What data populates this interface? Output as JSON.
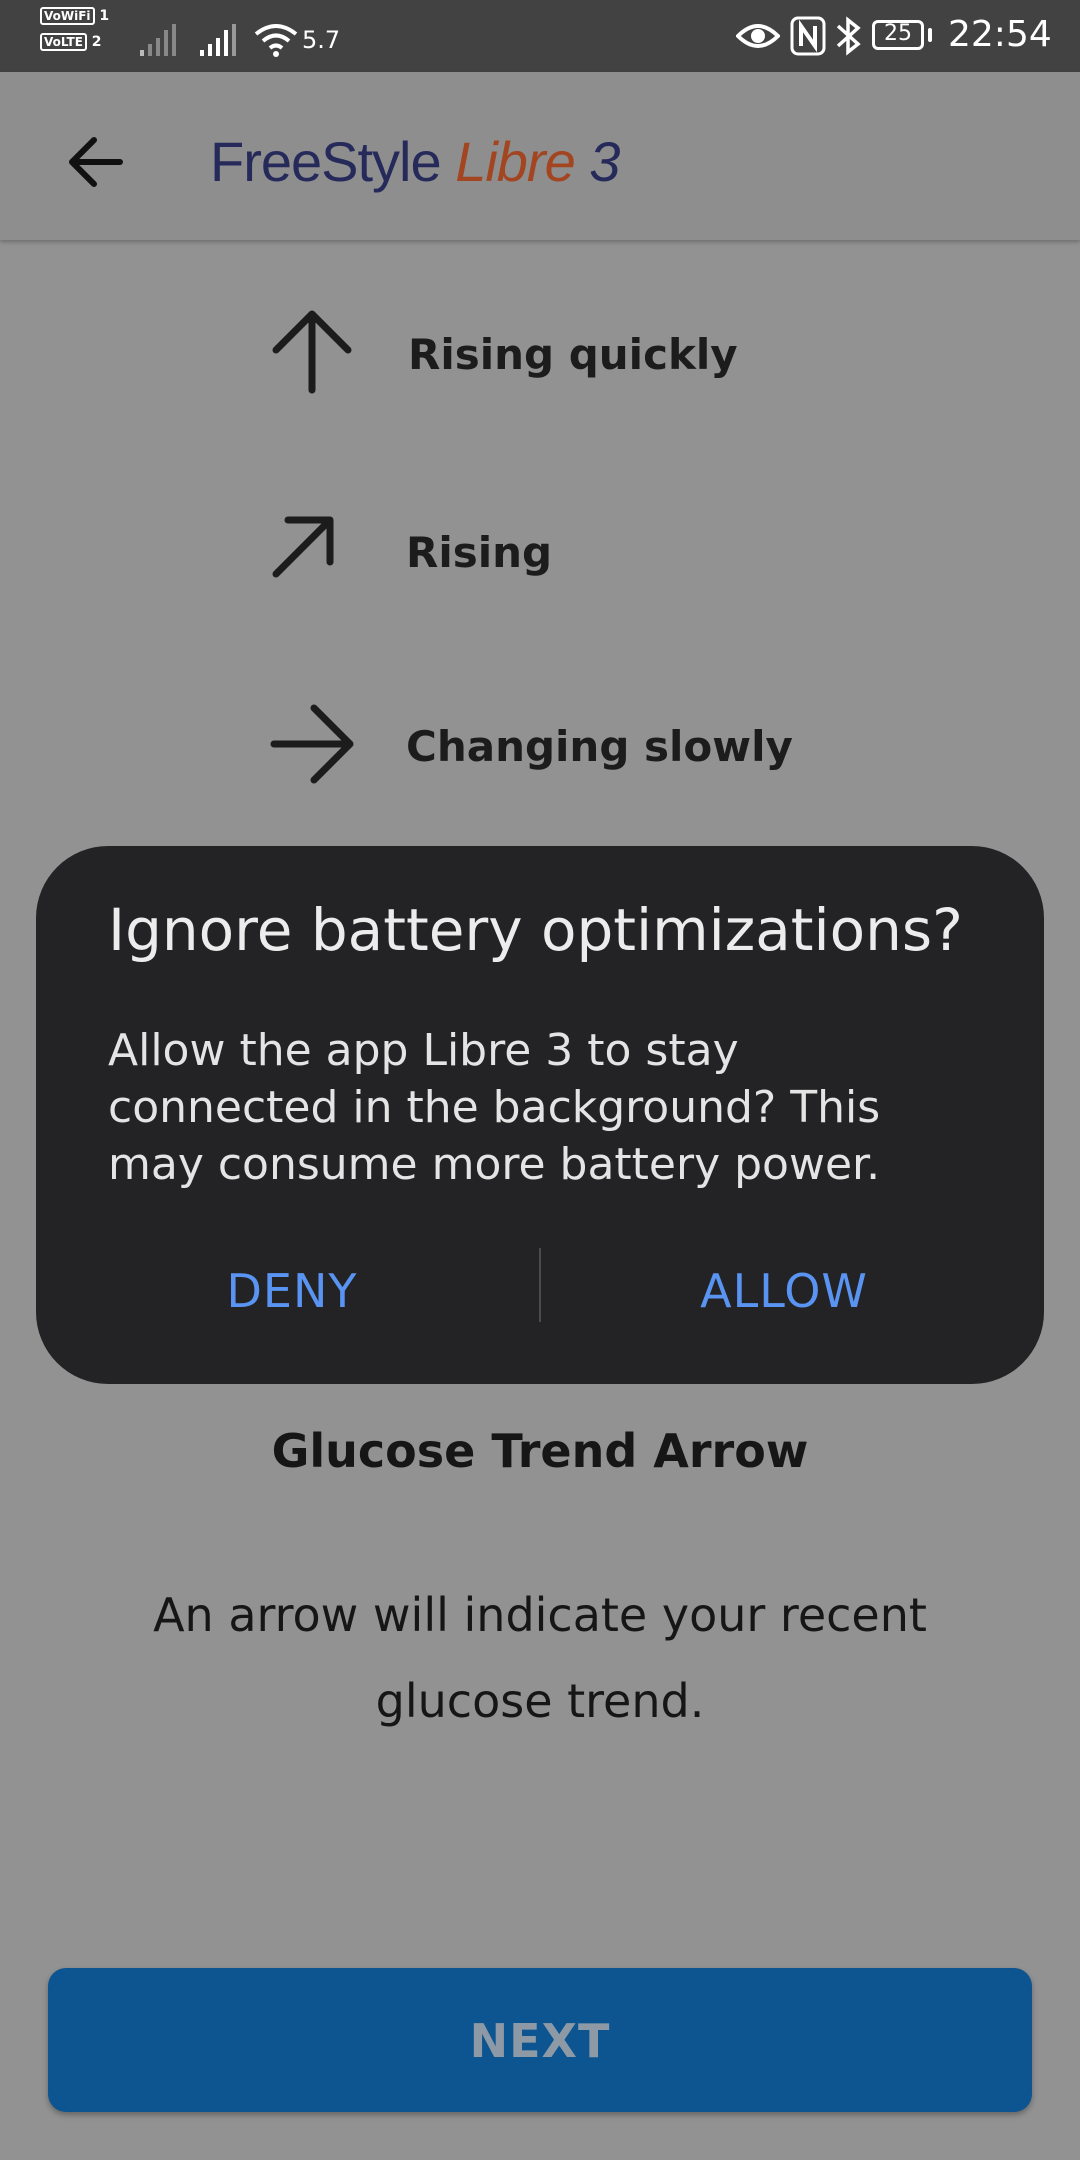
{
  "status_bar": {
    "sim1_label": "VoWiFi",
    "sim1_num": "1",
    "sim2_label": "VoLTE",
    "sim2_num": "2",
    "network_speed": "5.7",
    "battery_level": "25",
    "time": "22:54"
  },
  "app_bar": {
    "logo_freestyle": "FreeStyle",
    "logo_libre": "Libre",
    "logo_3": "3"
  },
  "trend_items": [
    {
      "label": "Rising quickly",
      "icon": "arrow-up-icon"
    },
    {
      "label": "Rising",
      "icon": "arrow-up-right-icon"
    },
    {
      "label": "Changing slowly",
      "icon": "arrow-right-icon"
    }
  ],
  "content": {
    "title": "Glucose Trend Arrow",
    "description": "An arrow will indicate your recent glucose trend."
  },
  "next_button": {
    "label": "NEXT"
  },
  "dialog": {
    "title": "Ignore battery optimizations?",
    "body": "Allow the app Libre 3 to stay connected in the background? This may consume more battery power.",
    "deny_label": "DENY",
    "allow_label": "ALLOW"
  },
  "colors": {
    "dialog_bg": "#232325",
    "dialog_button": "#5a94f2",
    "next_button_bg": "#0c5590",
    "scrim_bg": "#929292"
  }
}
